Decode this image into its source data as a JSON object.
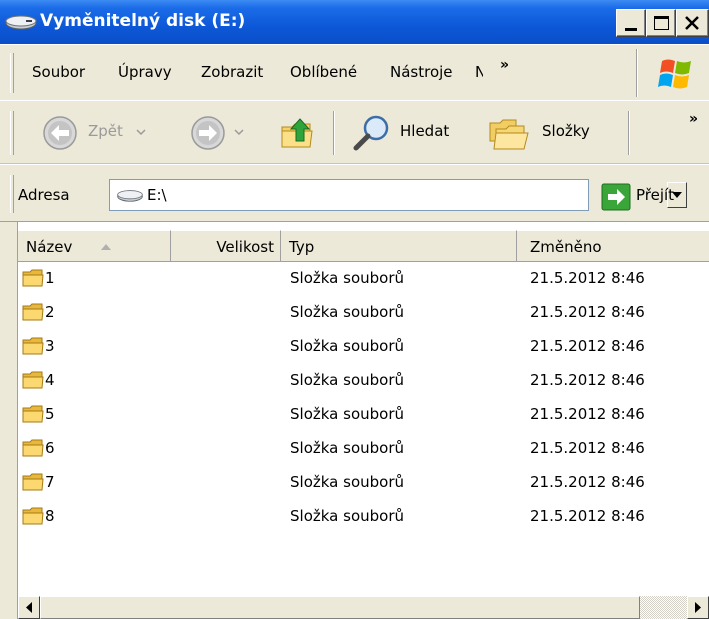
{
  "window": {
    "title": "Vyměnitelný disk (E:)",
    "titlebar_color": "#0a58d8"
  },
  "menu": {
    "items": [
      "Soubor",
      "Úpravy",
      "Zobrazit",
      "Oblíbené",
      "Nástroje",
      "N"
    ],
    "chevron": "»"
  },
  "toolbar": {
    "back_label": "Zpět",
    "search_label": "Hledat",
    "folders_label": "Složky",
    "chevron": "»"
  },
  "address": {
    "label": "Adresa",
    "value": "E:\\",
    "go_label": "Přejít"
  },
  "columns": [
    "Název",
    "Velikost",
    "Typ",
    "Změněno"
  ],
  "rows": [
    {
      "name": "1",
      "type": "Složka souborů",
      "modified": "21.5.2012 8:46"
    },
    {
      "name": "2",
      "type": "Složka souborů",
      "modified": "21.5.2012 8:46"
    },
    {
      "name": "3",
      "type": "Složka souborů",
      "modified": "21.5.2012 8:46"
    },
    {
      "name": "4",
      "type": "Složka souborů",
      "modified": "21.5.2012 8:46"
    },
    {
      "name": "5",
      "type": "Složka souborů",
      "modified": "21.5.2012 8:46"
    },
    {
      "name": "6",
      "type": "Složka souborů",
      "modified": "21.5.2012 8:46"
    },
    {
      "name": "7",
      "type": "Složka souborů",
      "modified": "21.5.2012 8:46"
    },
    {
      "name": "8",
      "type": "Složka souborů",
      "modified": "21.5.2012 8:46"
    }
  ]
}
